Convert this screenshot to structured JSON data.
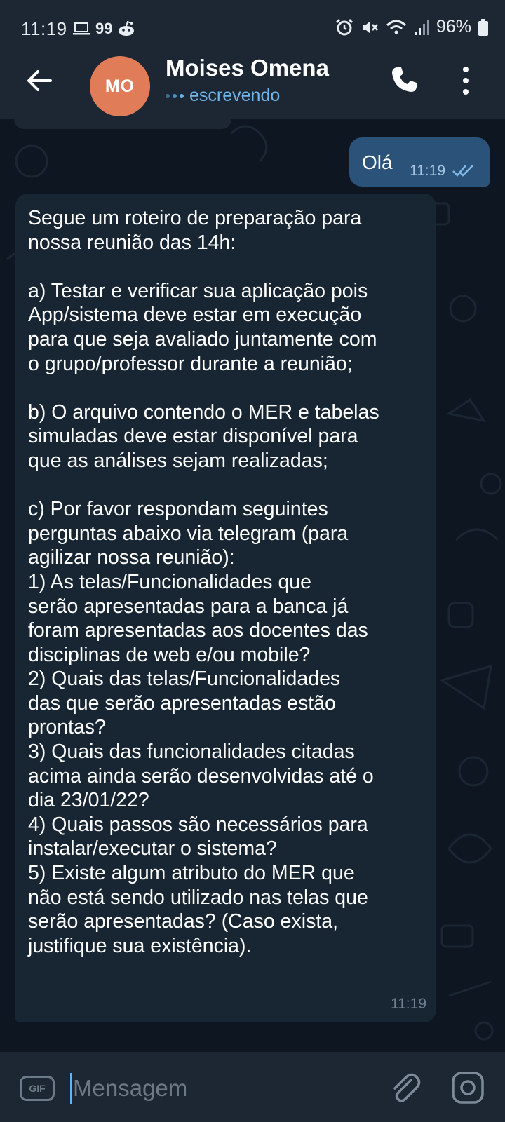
{
  "status_bar": {
    "time": "11:19",
    "notif_badge": "99",
    "battery": "96%"
  },
  "header": {
    "avatar_initials": "MO",
    "contact_name": "Moises Omena",
    "status": "escrevendo",
    "avatar_color": "#e17c59"
  },
  "messages": {
    "outgoing": {
      "text": "Olá",
      "time": "11:19",
      "status": "read"
    },
    "incoming": {
      "text": "Segue um roteiro de preparação para\nnossa reunião das 14h:\n\na) Testar e verificar sua aplicação pois\nApp/sistema deve estar em execução\npara que seja avaliado juntamente com\no grupo/professor durante a reunião;\n\nb) O arquivo contendo o MER e tabelas\nsimuladas deve estar disponível para\nque as análises sejam realizadas;\n\nc) Por favor respondam seguintes\nperguntas abaixo via telegram (para\nagilizar nossa reunião):\n1) As telas/Funcionalidades que\nserão apresentadas para a banca já\nforam apresentadas aos docentes das\ndisciplinas de web e/ou mobile?\n2) Quais das telas/Funcionalidades\ndas que serão apresentadas estão\nprontas?\n3) Quais das funcionalidades citadas\nacima ainda serão desenvolvidas até o\ndia 23/01/22?\n4) Quais passos são necessários para\ninstalar/executar o sistema?\n5) Existe algum atributo do MER que\nnão está sendo utilizado nas telas que\nserão apresentadas? (Caso exista,\njustifique sua existência).",
      "time": "11:19"
    }
  },
  "input_bar": {
    "gif_label": "GIF",
    "placeholder": "Mensagem"
  },
  "colors": {
    "chat_bg": "#0e1621",
    "header_bg": "#1c2733",
    "bubble_out": "#2b5278",
    "bubble_in": "#182533",
    "accent": "#5eb5f7"
  }
}
